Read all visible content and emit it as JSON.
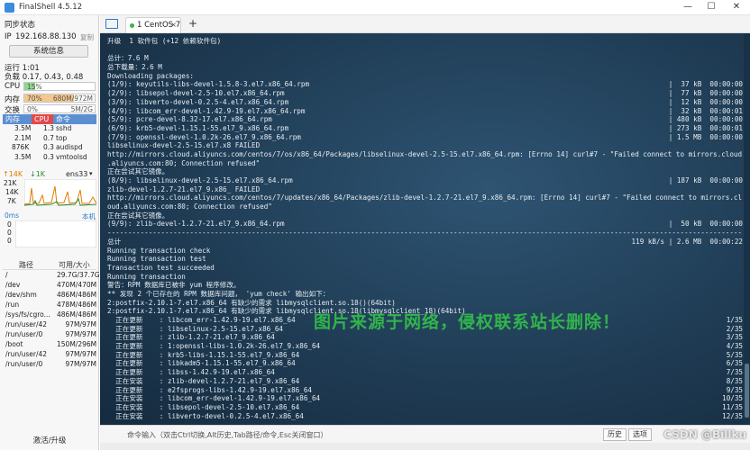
{
  "window": {
    "title": "FinalShell 4.5.12",
    "minimize": "—",
    "maximize": "☐",
    "close": "✕"
  },
  "sidebar": {
    "sync_status": "同步状态",
    "ip_label": "IP",
    "ip": "192.168.88.130",
    "copy_label": "复制",
    "sysinfo_button": "系统信息",
    "uptime": "运行 1:01",
    "load": "负载 0.17, 0.43, 0.48",
    "cpu": {
      "label": "CPU",
      "percent": 15,
      "text": "15%"
    },
    "mem": {
      "label": "内存",
      "percent": 70,
      "text": "70%",
      "value": "680M/972M"
    },
    "swap": {
      "label": "交换",
      "percent": 0,
      "text": "0%",
      "value": "5M/2G"
    },
    "proc_headers": [
      "内存",
      "CPU",
      "命令"
    ],
    "processes": [
      {
        "mem": "3.5M",
        "cpu": "1.3",
        "cmd": "sshd"
      },
      {
        "mem": "2.1M",
        "cpu": "0.7",
        "cmd": "top"
      },
      {
        "mem": "876K",
        "cpu": "0.3",
        "cmd": "audispd"
      },
      {
        "mem": "3.5M",
        "cpu": "0.3",
        "cmd": "vmtoolsd"
      }
    ],
    "net": {
      "up": "↑14K",
      "down": "↓1K",
      "iface": "ens33",
      "ticks": [
        "21K",
        "14K",
        "7K"
      ]
    },
    "latency": {
      "label": "0ms",
      "host": "本机",
      "ticks": [
        "0",
        "0",
        "0"
      ]
    },
    "disk_headers": [
      "路径",
      "可用/大小"
    ],
    "disks": [
      {
        "path": "/",
        "size": "29.7G/37.7G"
      },
      {
        "path": "/dev",
        "size": "470M/470M"
      },
      {
        "path": "/dev/shm",
        "size": "486M/486M"
      },
      {
        "path": "/run",
        "size": "478M/486M"
      },
      {
        "path": "/sys/fs/cgro...",
        "size": "486M/486M"
      },
      {
        "path": "/run/user/42",
        "size": "97M/97M"
      },
      {
        "path": "/run/user/0",
        "size": "97M/97M"
      },
      {
        "path": "/boot",
        "size": "150M/296M"
      },
      {
        "path": "/run/user/42",
        "size": "97M/97M"
      },
      {
        "path": "/run/user/0",
        "size": "97M/97M"
      }
    ],
    "upgrade": "激活/升级"
  },
  "tabs": [
    {
      "label": "1 CentOS 7",
      "close": "×"
    }
  ],
  "tab_add": "+",
  "terminal": {
    "lines": [
      {
        "text": "升级  1 软件包 (+12 依赖软件包)",
        "right": ""
      },
      {
        "text": "",
        "right": ""
      },
      {
        "text": "总计：7.6 M",
        "right": ""
      },
      {
        "text": "总下载量：2.6 M",
        "right": ""
      },
      {
        "text": "Downloading packages:",
        "right": ""
      },
      {
        "text": "(1/9): keyutils-libs-devel-1.5.8-3.el7.x86_64.rpm",
        "right": "|  37 kB  00:00:00"
      },
      {
        "text": "(2/9): libsepol-devel-2.5-10.el7.x86_64.rpm",
        "right": "|  77 kB  00:00:00"
      },
      {
        "text": "(3/9): libverto-devel-0.2.5-4.el7.x86_64.rpm",
        "right": "|  12 kB  00:00:00"
      },
      {
        "text": "(4/9): libcom_err-devel-1.42.9-19.el7.x86_64.rpm",
        "right": "|  32 kB  00:00:01"
      },
      {
        "text": "(5/9): pcre-devel-8.32-17.el7.x86_64.rpm",
        "right": "| 480 kB  00:00:00"
      },
      {
        "text": "(6/9): krb5-devel-1.15.1-55.el7_9.x86_64.rpm",
        "right": "| 273 kB  00:00:01"
      },
      {
        "text": "(7/9): openssl-devel-1.0.2k-26.el7_9.x86_64.rpm",
        "right": "| 1.5 MB  00:00:00"
      },
      {
        "text": "libselinux-devel-2.5-15.el7.x8 FAILED",
        "right": ""
      },
      {
        "text": "http://mirrors.cloud.aliyuncs.com/centos/7/os/x86_64/Packages/libselinux-devel-2.5-15.el7.x86_64.rpm: [Errno 14] curl#7 - \"Failed connect to mirrors.cloud",
        "right": ""
      },
      {
        "text": ".aliyuncs.com:80; Connection refused\"",
        "right": ""
      },
      {
        "text": "正在尝试其它镜像。",
        "right": ""
      },
      {
        "text": "(8/9): libselinux-devel-2.5-15.el7.x86_64.rpm",
        "right": "| 187 kB  00:00:00"
      },
      {
        "text": "zlib-devel-1.2.7-21.el7_9.x86_ FAILED",
        "right": ""
      },
      {
        "text": "http://mirrors.cloud.aliyuncs.com/centos/7/updates/x86_64/Packages/zlib-devel-1.2.7-21.el7_9.x86_64.rpm: [Errno 14] curl#7 - \"Failed connect to mirrors.cl",
        "right": ""
      },
      {
        "text": "oud.aliyuncs.com:80; Connection refused\"",
        "right": ""
      },
      {
        "text": "正在尝试其它镜像。",
        "right": ""
      },
      {
        "text": "(9/9): zlib-devel-1.2.7-21.el7_9.x86_64.rpm",
        "right": "|  50 kB  00:00:00"
      },
      {
        "text": "------------------------------------------------------------------------------------------------------------------------------------------------------------",
        "right": ""
      },
      {
        "text": "总计",
        "right": "119 kB/s | 2.6 MB  00:00:22"
      },
      {
        "text": "Running transaction check",
        "right": ""
      },
      {
        "text": "Running transaction test",
        "right": ""
      },
      {
        "text": "Transaction test succeeded",
        "right": ""
      },
      {
        "text": "Running transaction",
        "right": ""
      },
      {
        "text": "警告：RPM 数据库已被非 yum 程序修改。",
        "right": ""
      },
      {
        "text": "** 发现 2 个已存在的 RPM 数据库问题， 'yum check' 输出如下：",
        "right": ""
      },
      {
        "text": "2:postfix-2.10.1-7.el7.x86_64 有缺少的需求 libmysqlclient.so.18()(64bit)",
        "right": ""
      },
      {
        "text": "2:postfix-2.10.1-7.el7.x86_64 有缺少的需求 libmysqlclient.so.18(libmysqlclient_18)(64bit)",
        "right": ""
      },
      {
        "text": "  正在更新    : libcom_err-1.42.9-19.el7.x86_64",
        "right": "1/35"
      },
      {
        "text": "  正在更新    : libselinux-2.5-15.el7.x86_64",
        "right": "2/35"
      },
      {
        "text": "  正在更新    : zlib-1.2.7-21.el7_9.x86_64",
        "right": "3/35"
      },
      {
        "text": "  正在更新    : 1:openssl-libs-1.0.2k-26.el7_9.x86_64",
        "right": "4/35"
      },
      {
        "text": "  正在更新    : krb5-libs-1.15.1-55.el7_9.x86_64",
        "right": "5/35"
      },
      {
        "text": "  正在更新    : libkadm5-1.15.1-55.el7_9.x86_64",
        "right": "6/35"
      },
      {
        "text": "  正在更新    : libss-1.42.9-19.el7.x86_64",
        "right": "7/35"
      },
      {
        "text": "  正在安装    : zlib-devel-1.2.7-21.el7_9.x86_64",
        "right": "8/35"
      },
      {
        "text": "  正在更新    : e2fsprogs-libs-1.42.9-19.el7.x86_64",
        "right": "9/35"
      },
      {
        "text": "  正在安装    : libcom_err-devel-1.42.9-19.el7.x86_64",
        "right": "10/35"
      },
      {
        "text": "  正在安装    : libsepol-devel-2.5-10.el7.x86_64",
        "right": "11/35"
      },
      {
        "text": "  正在安装    : libverto-devel-0.2.5-4.el7.x86_64",
        "right": "12/35"
      }
    ],
    "watermark": "图片来源于网络，侵权联系站长删除！"
  },
  "command_bar": {
    "input_placeholder": "命令输入（双击Ctrl切换,Alt历史,Tab路径/命令,Esc关闭窗口）",
    "history_button": "历史",
    "options_button": "选项",
    "extra_button": "  "
  },
  "overlay": {
    "csdn": "CSDN @Billku"
  },
  "colors": {
    "terminal_bg": "#1f3c55",
    "cpu_fill": "#8fd78f",
    "mem_fill": "#f6c88e",
    "proc_header_mem": "#5b8fd1",
    "proc_header_cpu": "#e04a4a",
    "proc_header_cmd": "#5b8fd1",
    "watermark": "#34c84a"
  },
  "icons": {
    "app": "finalshell-icon",
    "folder": "folder-icon"
  }
}
